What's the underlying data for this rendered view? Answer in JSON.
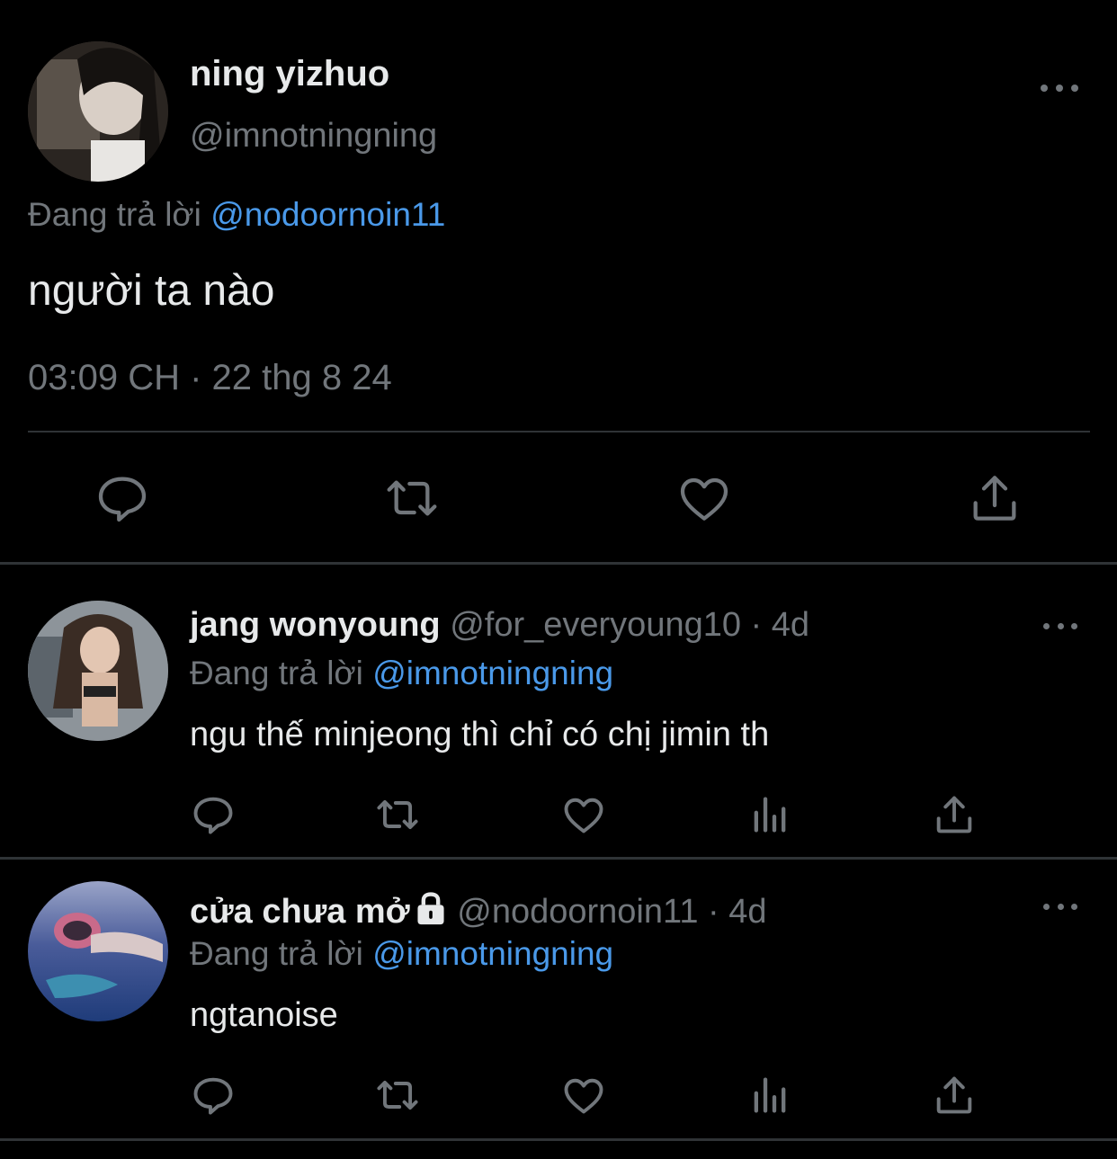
{
  "main_tweet": {
    "name": "ning yizhuo",
    "handle": "@imnotningning",
    "reply_prefix": "Đang trả lời",
    "reply_mention": "@nodoornoin11",
    "text": "người ta nào",
    "timestamp": "03:09 CH · 22 thg 8 24"
  },
  "replies": [
    {
      "name": "jang wonyoung",
      "handle": "@for_everyoung10",
      "age": "· 4d",
      "reply_prefix": "Đang trả lời",
      "reply_mention": "@imnotningning",
      "text": "ngu thế minjeong thì chỉ có chị jimin th",
      "locked": false
    },
    {
      "name": "cửa chưa mở",
      "handle": "@nodoornoin11",
      "age": "· 4d",
      "reply_prefix": "Đang trả lời",
      "reply_mention": "@imnotningning",
      "text": "ngtanoise",
      "locked": true
    }
  ],
  "icons": {
    "more": "more-horizontal-icon",
    "reply": "comment-icon",
    "retweet": "retweet-icon",
    "like": "heart-icon",
    "views": "bar-chart-icon",
    "share": "share-icon",
    "lock": "lock-icon"
  },
  "colors": {
    "background": "#000000",
    "primary_text": "#e7e9ea",
    "secondary_text": "#71767b",
    "mention": "#4a99e9",
    "divider": "#2f3336"
  }
}
